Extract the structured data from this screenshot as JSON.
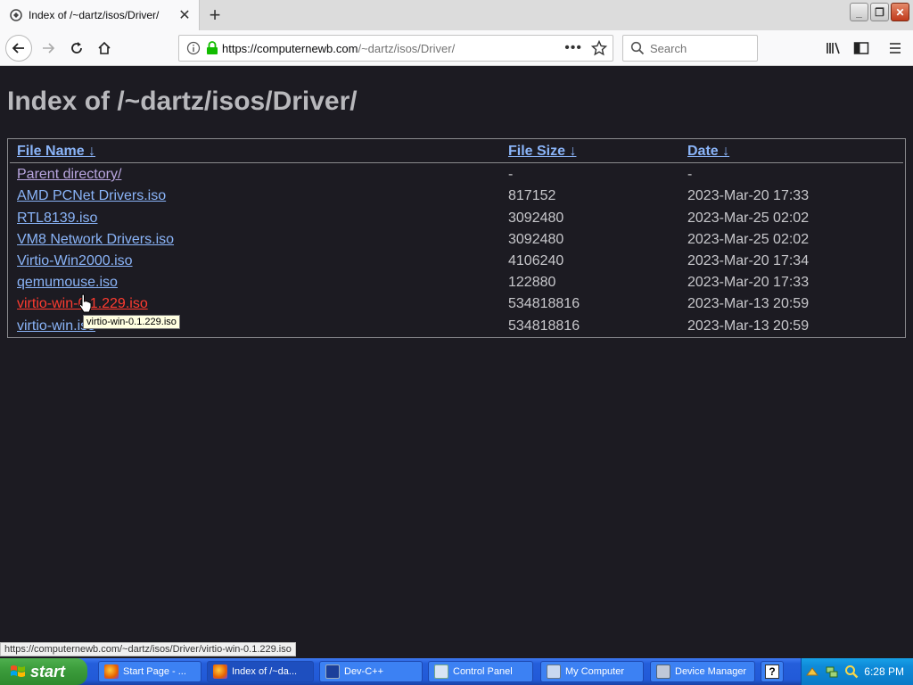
{
  "browser": {
    "tab": {
      "title": "Index of /~dartz/isos/Driver/"
    },
    "url": {
      "host": "https://computernewb.com",
      "path": "/~dartz/isos/Driver/"
    },
    "search": {
      "placeholder": "Search"
    },
    "icons": [
      "back-icon",
      "forward-icon",
      "reload-icon",
      "home-icon",
      "info-icon",
      "lock-icon",
      "more-icon",
      "bookmark-star-icon",
      "search-icon",
      "library-icon",
      "sidebar-icon",
      "menu-icon"
    ]
  },
  "page": {
    "heading": "Index of /~dartz/isos/Driver/",
    "columns": {
      "name": "File Name  ↓",
      "size": "File Size  ↓",
      "date": "Date  ↓"
    },
    "rows": [
      {
        "name": "Parent directory/",
        "size": "-",
        "date": "-",
        "state": "visited"
      },
      {
        "name": "AMD PCNet Drivers.iso",
        "size": "817152",
        "date": "2023-Mar-20 17:33",
        "state": "link"
      },
      {
        "name": "RTL8139.iso",
        "size": "3092480",
        "date": "2023-Mar-25 02:02",
        "state": "link"
      },
      {
        "name": "VM8 Network Drivers.iso",
        "size": "3092480",
        "date": "2023-Mar-25 02:02",
        "state": "link"
      },
      {
        "name": "Virtio-Win2000.iso",
        "size": "4106240",
        "date": "2023-Mar-20 17:34",
        "state": "link"
      },
      {
        "name": "qemumouse.iso",
        "size": "122880",
        "date": "2023-Mar-20 17:33",
        "state": "link"
      },
      {
        "name": "virtio-win-0.1.229.iso",
        "size": "534818816",
        "date": "2023-Mar-13 20:59",
        "state": "active"
      },
      {
        "name": "virtio-win.iso",
        "size": "534818816",
        "date": "2023-Mar-13 20:59",
        "state": "link"
      }
    ],
    "tooltip": "virtio-win-0.1.229.iso",
    "status_url": "https://computernewb.com/~dartz/isos/Driver/virtio-win-0.1.229.iso"
  },
  "taskbar": {
    "start_label": "start",
    "tasks": [
      {
        "label": "Start Page - ...",
        "icon": "firefox-icon"
      },
      {
        "label": "Index of /~da...",
        "icon": "firefox-icon",
        "active": true
      },
      {
        "label": "Dev-C++",
        "icon": "devcpp-icon"
      },
      {
        "label": "Control Panel",
        "icon": "control-panel-icon"
      },
      {
        "label": "My Computer",
        "icon": "my-computer-icon"
      },
      {
        "label": "Device Manager",
        "icon": "device-manager-icon"
      }
    ],
    "clock": "6:28 PM"
  },
  "colors": {
    "page_bg": "#1c1b22",
    "link": "#8ab4f8",
    "visited": "#b9a6e0",
    "active_link": "#ff3b30",
    "taskbar_blue": "#245edb",
    "start_green": "#3c9d3c"
  }
}
